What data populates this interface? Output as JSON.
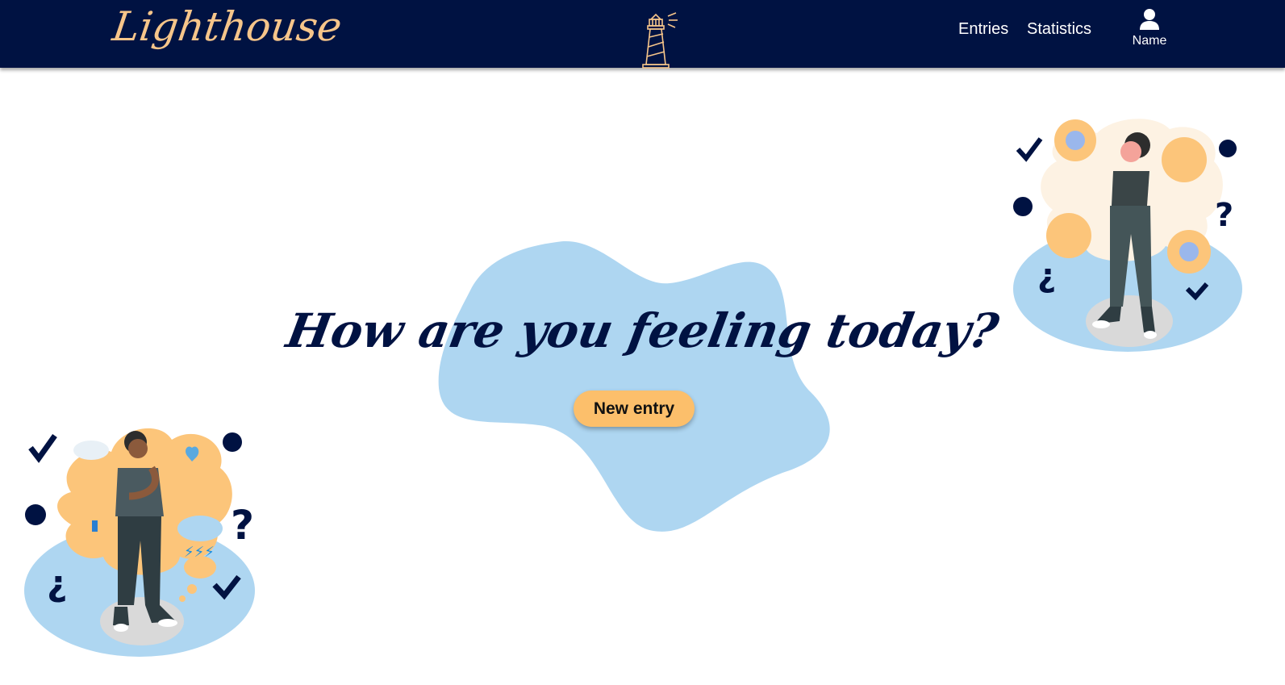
{
  "brand": {
    "name": "Lighthouse",
    "accent_color": "#f6c58a"
  },
  "header": {
    "logo_icon": "lighthouse-icon",
    "nav": {
      "entries_label": "Entries",
      "statistics_label": "Statistics"
    },
    "profile": {
      "icon": "user-icon",
      "label": "Name"
    },
    "background_color": "#001242"
  },
  "hero": {
    "headline": "How are you feeling today?",
    "button_label": "New entry",
    "button_color": "#fcbf6b",
    "blob_color": "#aed6f1"
  },
  "illustrations": {
    "left": {
      "icon": "thinking-man-illustration"
    },
    "right": {
      "icon": "thinking-woman-illustration"
    }
  }
}
